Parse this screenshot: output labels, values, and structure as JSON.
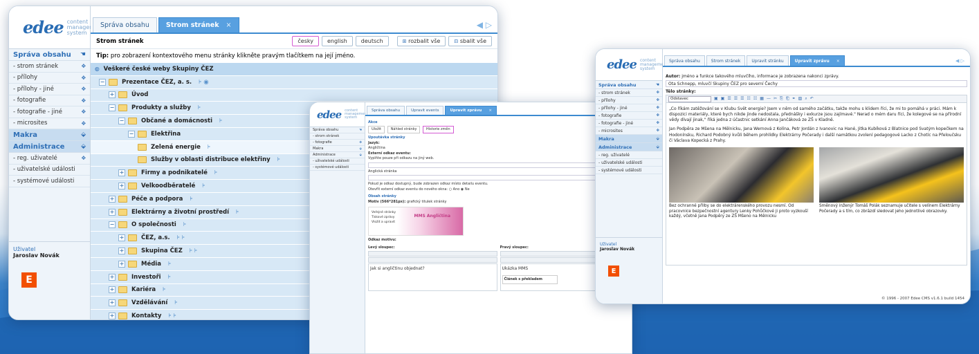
{
  "left_window": {
    "logo": {
      "mark": "edee",
      "text_lines": [
        "content",
        "management",
        "system"
      ]
    },
    "sidebar": {
      "section1": "Správa obsahu",
      "items1": [
        "- strom stránek",
        "- přílohy",
        "- přílohy - jiné",
        "- fotografie",
        "- fotografie - jiné",
        "- microsites"
      ],
      "section2": "Makra",
      "section3": "Administrace",
      "items3": [
        "- reg. uživatelé",
        "- uživatelské události",
        "- systémové události"
      ],
      "user_label": "Uživatel",
      "user_name": "Jaroslav Novák",
      "brand_icon": "cez-logo"
    },
    "tabs": [
      "Správa obsahu",
      "Strom stránek"
    ],
    "tab_close": "×",
    "toolbar": {
      "title": "Strom stránek",
      "lang_buttons": [
        "česky",
        "english",
        "deutsch"
      ],
      "expand_all": "rozbalit vše",
      "collapse_all": "sbalit vše"
    },
    "tip": {
      "bold": "Tip:",
      "text": "pro zobrazení kontextového menu stránky klikněte pravým tlačítkem na její jméno."
    },
    "tree": [
      "Veškeré české weby Skupiny ČEZ",
      "Prezentace ČEZ, a. s.",
      "Úvod",
      "Produkty a služby",
      "Občané a domácnosti",
      "Elektřina",
      "Zelená energie",
      "Služby v oblasti distribuce elektřiny",
      "Firmy a podnikatelé",
      "Velkoodběratelé",
      "Péče a podpora",
      "Elektrárny a životní prostředí",
      "O společnosti",
      "ČEZ, a.s.",
      "Skupina ČEZ",
      "Média",
      "Investoři",
      "Kariéra",
      "Vzdělávání",
      "Kontakty"
    ]
  },
  "middle_window": {
    "logo": {
      "mark": "edee",
      "text_lines": [
        "content",
        "management",
        "system"
      ]
    },
    "sidebar": {
      "items": [
        "Správa obsahu",
        "- strom stránek",
        "- fotografie",
        "Makra",
        "Administrace",
        "- uživatelské události",
        "- systémové události"
      ]
    },
    "tabs": [
      "Správa obsahu",
      "Upravit events",
      "Upravit zprávu"
    ],
    "tab_close": "×",
    "akce": "Akce",
    "buttons": [
      "Uložit",
      "Náhled stránky",
      "Historie změn"
    ],
    "section_title": "Upoutávka stránky",
    "label_lang": "Jazyk:",
    "value_lang": "Angličtina",
    "label_ext": "Externí odkaz eventu:",
    "hint_ext": "Vyplňte pouze při odkazu na jiný web.",
    "field2": "Anglická stránka",
    "note": "Pokud je odkaz dostupný, bude zobrazen odkaz místo detailu eventu.",
    "radio_label": "Otevřít externí odkaz eventu do nového okna:",
    "radio_yes": "Ano",
    "radio_no": "Ne",
    "obsah": "Obsah stránky",
    "motiv_label": "Motiv (566*281px):",
    "motiv_hint": "grafický titulek stránky",
    "banner_menu": [
      "Veřejné stránky",
      "Tiskové zprávy",
      "Vložit a upravit"
    ],
    "banner_text": "MMS Angličtina",
    "odkaz_label": "Odkaz motivu:",
    "left_col": "Levý sloupec:",
    "right_col": "Pravý sloupec:",
    "left_heading": "Jak si angličtinu objednat?",
    "right_heading": "Ukázka MMS",
    "right_box": "Článek s překladem"
  },
  "right_window": {
    "logo": {
      "mark": "edee",
      "text_lines": [
        "content",
        "management",
        "system"
      ]
    },
    "sidebar": {
      "section1": "Správa obsahu",
      "items1": [
        "- strom stránek",
        "- přílohy",
        "- přílohy - jiné",
        "- fotografie",
        "- fotografie - jiné",
        "- microsites"
      ],
      "section2": "Makra",
      "section3": "Administrace",
      "items3": [
        "- reg. uživatelé",
        "- uživatelské události",
        "- systémové události"
      ],
      "user_label": "Uživatel",
      "user_name": "Jaroslav Novák",
      "brand_icon": "cez-logo"
    },
    "tabs": [
      "Správa obsahu",
      "Strom stránek",
      "Upravit stránku",
      "Upravit zprávu"
    ],
    "tab_close": "×",
    "autor_label": "Autor:",
    "autor_hint": "jméno a funkce takového mluvčího, informace je zobrazena nakonci zprávy.",
    "autor_value": "Ota Schnepp, mluvčí Skupiny ČEZ pro severní Čechy",
    "body_label": "Tělo stránky:",
    "format_select": "Odstavec",
    "paragraph1": "„Co říkám zatěžování se v Klubu Svět energie? Jsem v něm od samého začátku, takže mohu s klidem říci, že mi to pomáhá v práci. Mám k dispozici materiály, které bych nikde jinde nedostala, přednášky i exkurze jsou zajímavé.\" Nerad o mém daru říci, že kolegové se na přírodní vědy dívají jinak,\" říká jedna z účastnic setkání Anna Jančáková ze ZŠ v Kladně.",
    "paragraph2": "Jan Podpěra ze Mšena na Mělnicku, Jana Wernová z Kolína, Petr Jordán z Ivanovic na Hané, Jitka Kubíková z Blatnice pod Svatým kopečkem na Hodonínsku, Richard Podobný kvůli během prohlídky Elektrárny Počerady i další namátkou zvolení pedagogové Lacko z Chotíc na Přeloučsku či Václava Kopecká z Prahy.",
    "caption1": "Bez ochranné přilby se do elektrárenského provozu nesmí. Od pracovnice bezpečnostní agentury Lenky Pohůčkové ji proto vyzkouší každý, včetně Jana Podpěry ze ZŠ Mšeno na Mělnicku",
    "caption2": "Směnový inženýr Tomáš Polák seznamuje učitele s velínem Elektrárny Počerady a s tím, co zbrázdí sledovat jeho jednotlivé obrazovky.",
    "footer": "© 1996 - 2007 Edee CMS v1.6.1 build 1454"
  }
}
